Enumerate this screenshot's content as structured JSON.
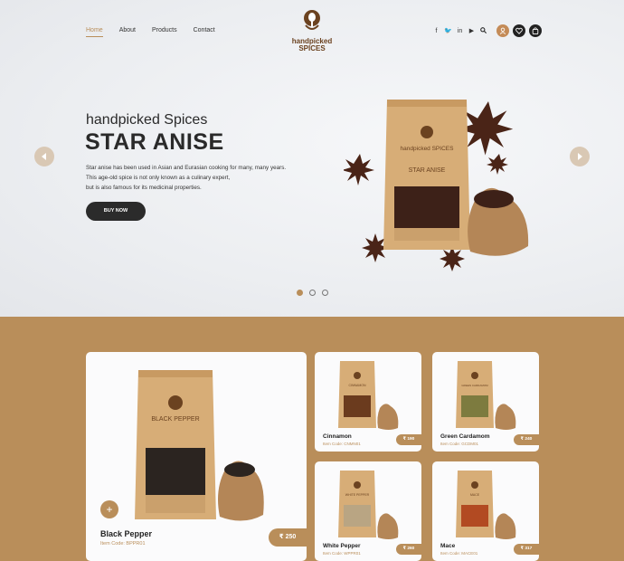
{
  "nav": {
    "items": [
      {
        "label": "Home",
        "active": true
      },
      {
        "label": "About",
        "active": false
      },
      {
        "label": "Products",
        "active": false
      },
      {
        "label": "Contact",
        "active": false
      }
    ]
  },
  "brand": {
    "line1": "handpicked",
    "line2": "SPICES"
  },
  "header_icons": [
    "facebook-icon",
    "twitter-icon",
    "linkedin-icon",
    "youtube-icon",
    "search-icon",
    "user-icon",
    "heart-icon",
    "bag-icon"
  ],
  "hero": {
    "subtitle": "handpicked Spices",
    "title": "STAR ANISE",
    "desc_lines": [
      "Star anise has been used in Asian and Eurasian cooking for many, many years.",
      "This age-old spice is not only known as a culinary expert,",
      "but is also famous for its medicinal properties."
    ],
    "cta": "BUY NOW",
    "pack_brand": "handpicked SPICES",
    "pack_label": "STAR ANISE",
    "slides": 3,
    "active_slide": 1
  },
  "products": [
    {
      "name": "Black Pepper",
      "code": "Item Code: BPPR01",
      "price": "₹ 250",
      "pack_label": "BLACK PEPPER",
      "fill": "#2b2420"
    },
    {
      "name": "Cinnamon",
      "code": "Item Code: CNMN01",
      "price": "₹ 190",
      "pack_label": "CINNAMON",
      "fill": "#6b3b1e"
    },
    {
      "name": "Green Cardamom",
      "code": "Item Code: GCDM01",
      "price": "₹ 240",
      "pack_label": "GREEN CARDAMOM",
      "fill": "#7d7b3f"
    },
    {
      "name": "White Pepper",
      "code": "Item Code: WPPR01",
      "price": "₹ 260",
      "pack_label": "WHITE PEPPER",
      "fill": "#b9a583"
    },
    {
      "name": "Mace",
      "code": "Item Code: MACE01",
      "price": "₹ 317",
      "pack_label": "MACE",
      "fill": "#b24a22"
    }
  ],
  "colors": {
    "accent": "#b98e5a",
    "dark": "#2b2b2b",
    "bag": "#d7ad77"
  }
}
